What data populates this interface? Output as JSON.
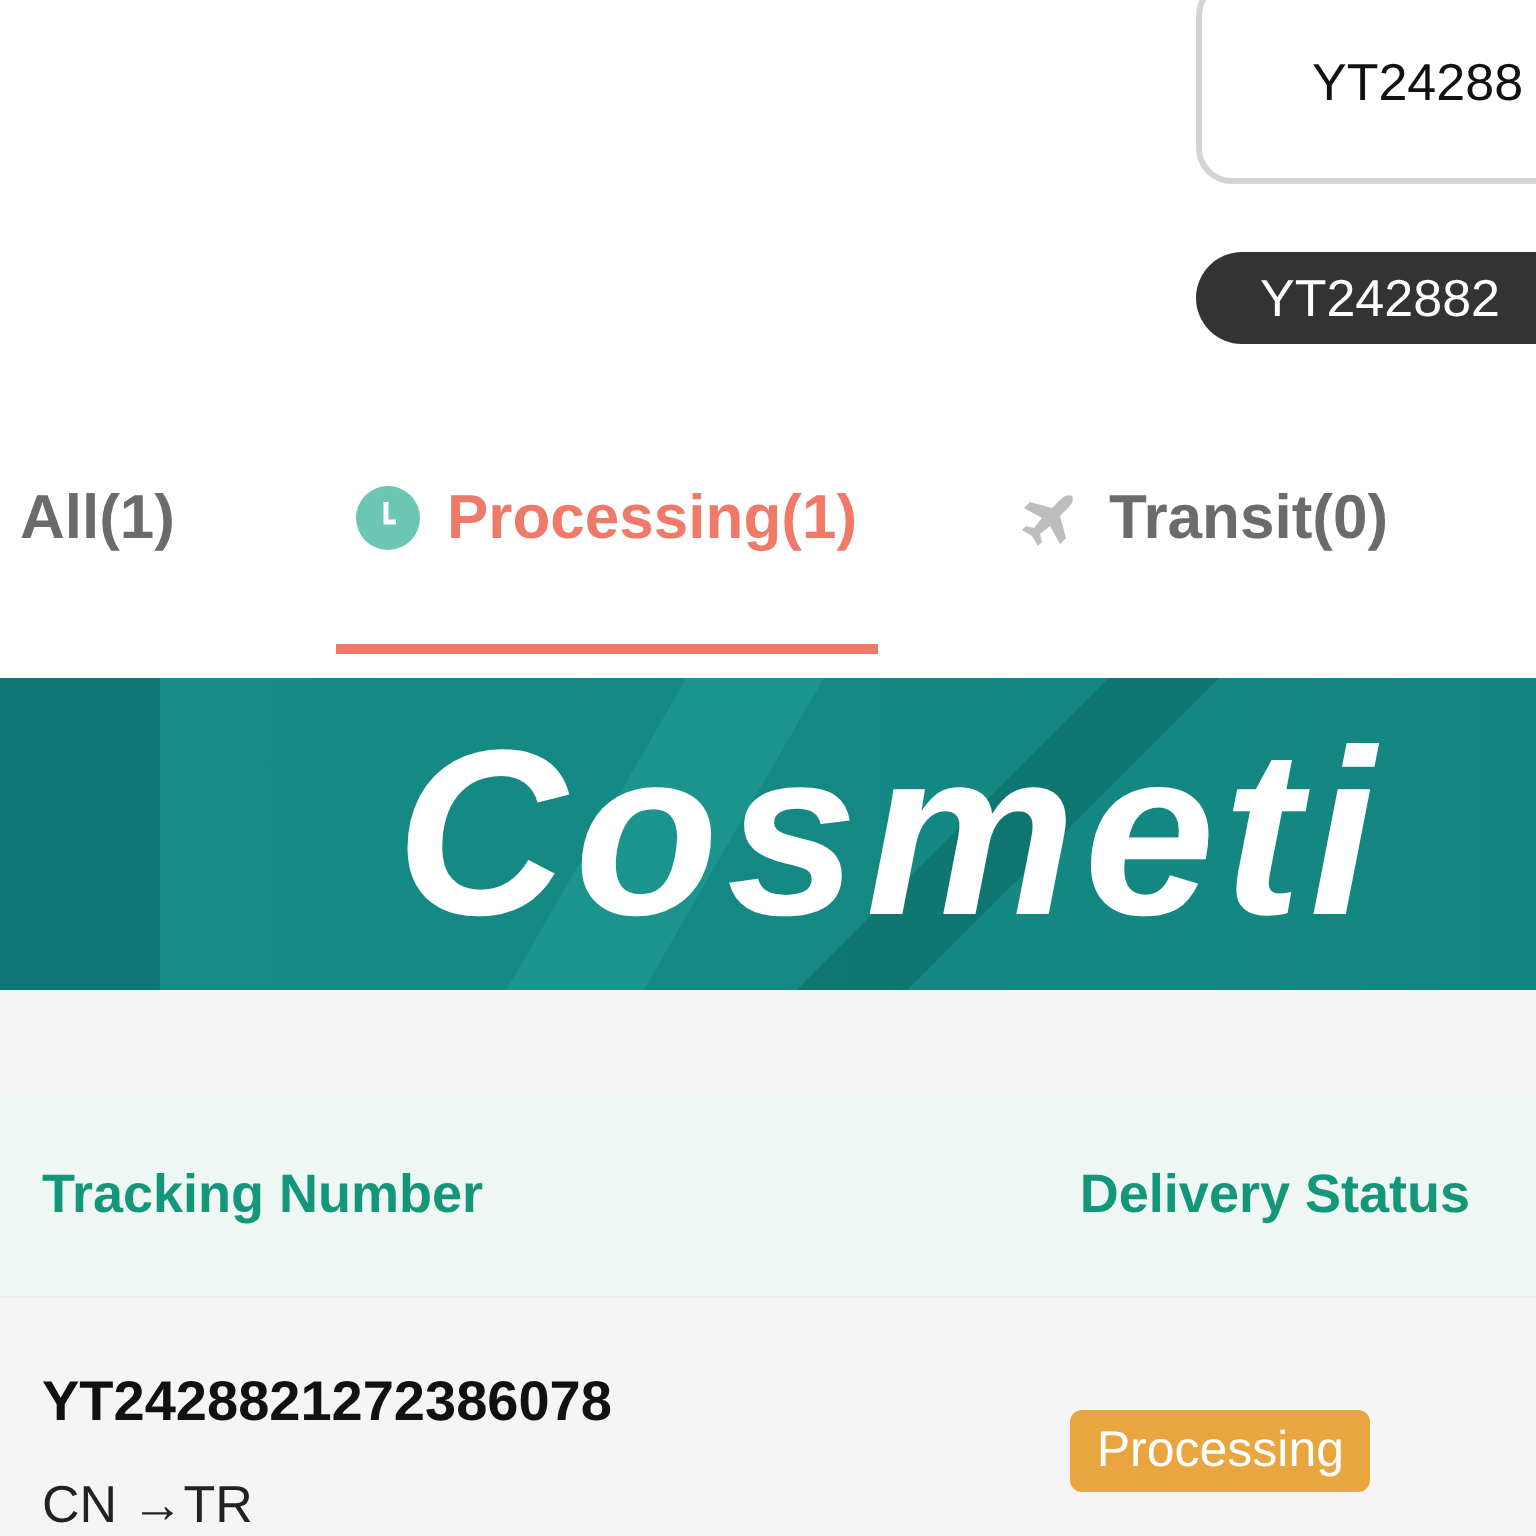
{
  "search": {
    "value": "YT24288"
  },
  "chip": {
    "label": "YT242882"
  },
  "tabs": [
    {
      "label": "All(1)",
      "kind": "plain",
      "selected": false
    },
    {
      "label": "Processing(1)",
      "kind": "clock",
      "selected": true
    },
    {
      "label": "Transit(0)",
      "kind": "plane",
      "selected": false
    }
  ],
  "banner": {
    "text": "Cosmeti"
  },
  "table": {
    "columns": [
      "Tracking Number",
      "Delivery Status"
    ],
    "rows": [
      {
        "tracking": "YT2428821272386078",
        "route": "CN →TR",
        "status": "Processing"
      }
    ]
  }
}
